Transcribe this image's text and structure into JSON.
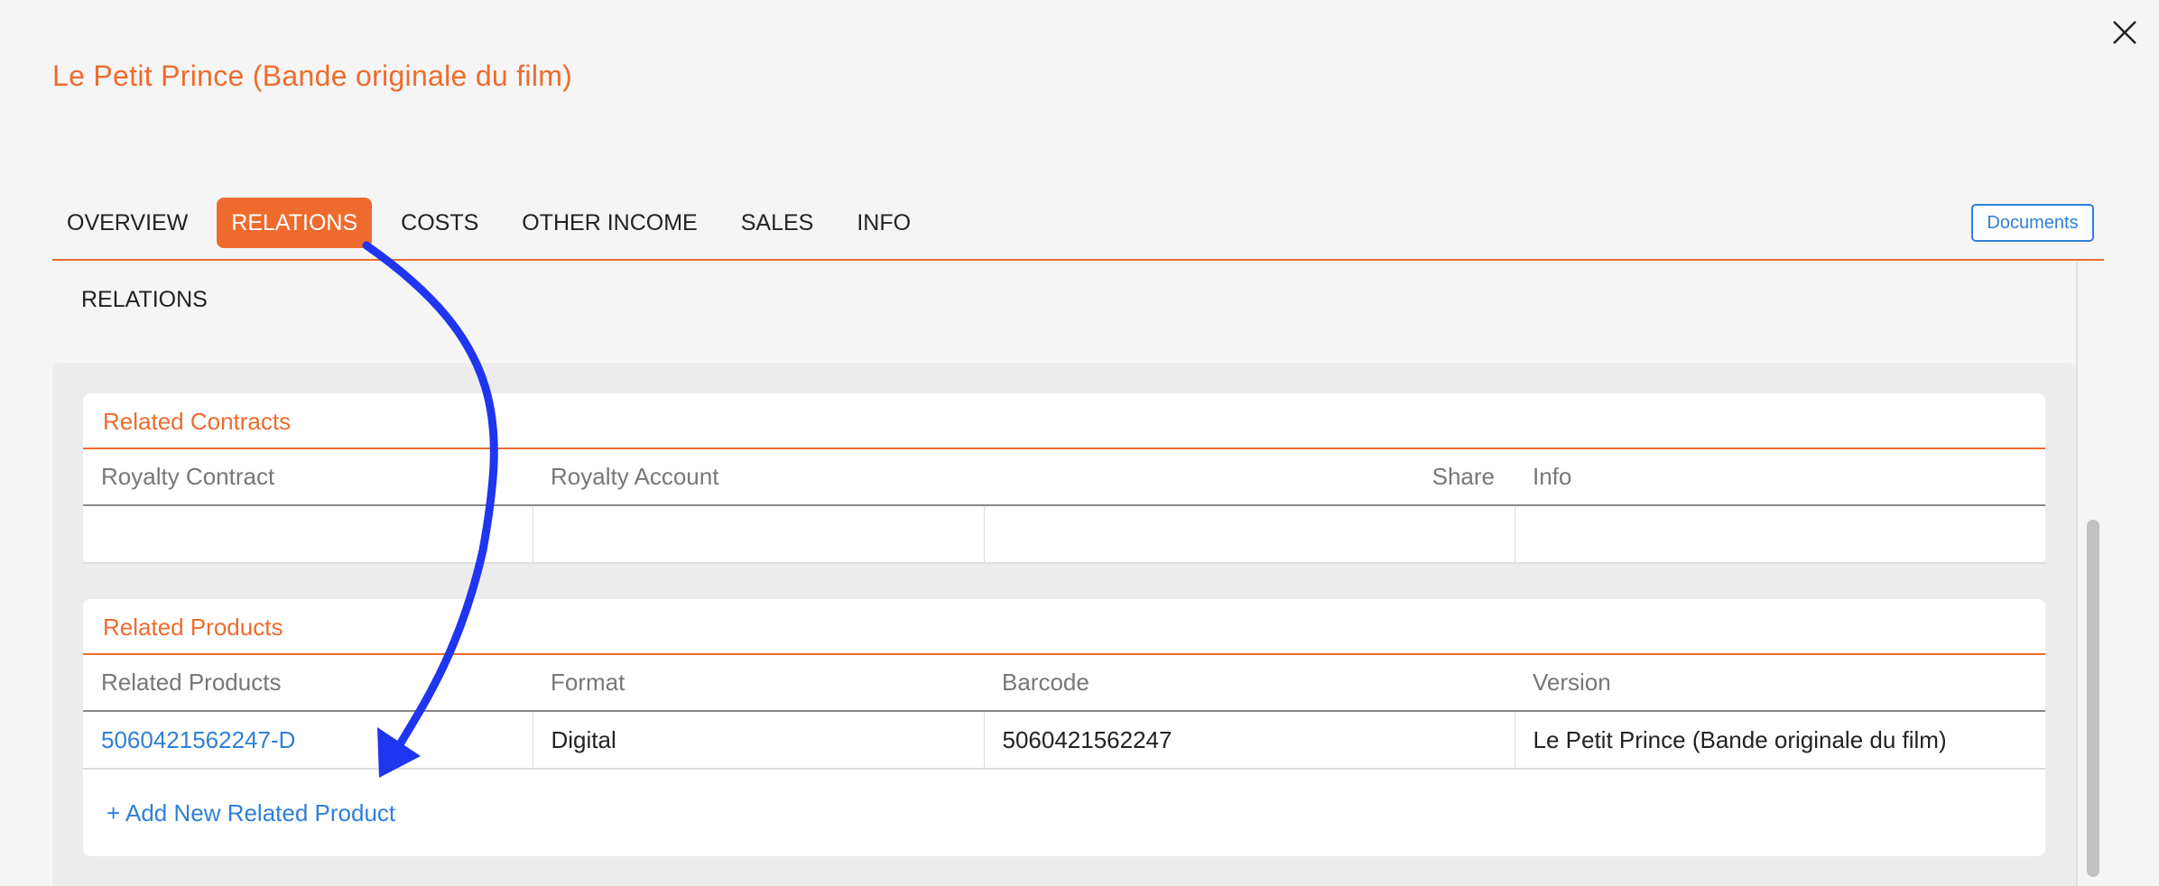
{
  "header": {
    "title": "Le Petit Prince (Bande originale du film)",
    "documents_label": "Documents"
  },
  "tabs": [
    {
      "label": "OVERVIEW",
      "active": false
    },
    {
      "label": "RELATIONS",
      "active": true
    },
    {
      "label": "COSTS",
      "active": false
    },
    {
      "label": "OTHER INCOME",
      "active": false
    },
    {
      "label": "SALES",
      "active": false
    },
    {
      "label": "INFO",
      "active": false
    }
  ],
  "section": {
    "heading": "RELATIONS"
  },
  "related_contracts": {
    "title": "Related Contracts",
    "columns": [
      "Royalty Contract",
      "Royalty Account",
      "Share",
      "Info"
    ],
    "rows": [
      [
        "",
        "",
        "",
        ""
      ]
    ]
  },
  "related_products": {
    "title": "Related Products",
    "columns": [
      "Related Products",
      "Format",
      "Barcode",
      "Version"
    ],
    "rows": [
      [
        "5060421562247-D",
        "Digital",
        "5060421562247",
        "Le Petit Prince (Bande originale du film)"
      ]
    ],
    "add_label": "+ Add New Related Product"
  },
  "colors": {
    "accent": "#ee6b2d",
    "link": "#2f7fd6",
    "annotation_arrow": "#1f35f0"
  },
  "icons": {
    "close": "close-icon"
  }
}
